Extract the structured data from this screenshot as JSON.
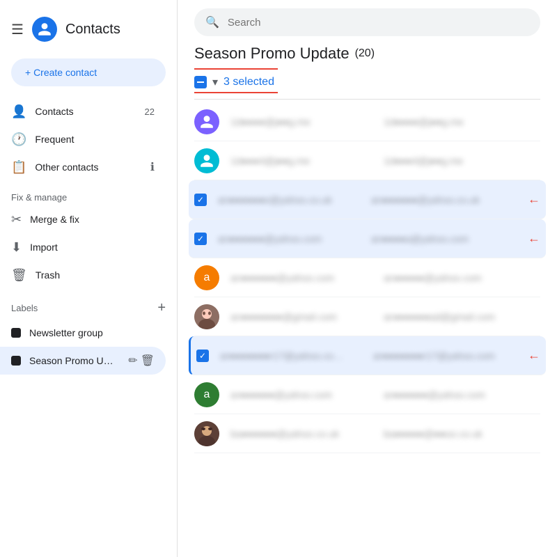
{
  "app": {
    "title": "Contacts"
  },
  "search": {
    "placeholder": "Search"
  },
  "sidebar": {
    "nav_items": [
      {
        "id": "contacts",
        "label": "Contacts",
        "count": "22",
        "icon": "👤"
      },
      {
        "id": "frequent",
        "label": "Frequent",
        "count": "",
        "icon": "🕐"
      },
      {
        "id": "other-contacts",
        "label": "Other contacts",
        "count": "",
        "icon": "📋"
      }
    ],
    "fix_manage_label": "Fix & manage",
    "fix_items": [
      {
        "id": "merge",
        "label": "Merge & fix",
        "icon": "✂"
      },
      {
        "id": "import",
        "label": "Import",
        "icon": "⬇"
      },
      {
        "id": "trash",
        "label": "Trash",
        "icon": "🗑"
      }
    ],
    "labels_title": "Labels",
    "labels": [
      {
        "id": "newsletter",
        "label": "Newsletter group",
        "active": false
      },
      {
        "id": "season",
        "label": "Season Promo U…",
        "active": true
      }
    ],
    "create_btn": "+ Create contact"
  },
  "main": {
    "page_title": "Season Promo Update",
    "page_count": "(20)",
    "selected_label": "3 selected",
    "contacts": [
      {
        "id": 1,
        "avatar_type": "purple",
        "avatar_text": "",
        "email1": "1d●●●●@j●●g.me",
        "email2": "1d●●●●@j●●g.me",
        "selected": false,
        "arrow": false,
        "left_border": false
      },
      {
        "id": 2,
        "avatar_type": "teal",
        "avatar_text": "",
        "email1": "1d●●●4@j●●g.me",
        "email2": "1d●●●4@j●●g.me",
        "selected": false,
        "arrow": false,
        "left_border": false
      },
      {
        "id": 3,
        "avatar_type": "checkbox",
        "avatar_text": "",
        "email1": "an●●●●●●e@yahoo.co.uk",
        "email2": "an●●●●●●@yahoo.co.uk",
        "selected": true,
        "arrow": true,
        "left_border": false
      },
      {
        "id": 4,
        "avatar_type": "checkbox",
        "avatar_text": "",
        "email1": "an●●●●●●@yahoo.com",
        "email2": "an●●●●a@yahoo.com",
        "selected": true,
        "arrow": true,
        "left_border": false
      },
      {
        "id": 5,
        "avatar_type": "orange",
        "avatar_text": "a",
        "email1": "an●●●●●●@yahoo.com",
        "email2": "an●●●●●@yahoo.com",
        "selected": false,
        "arrow": false,
        "left_border": false
      },
      {
        "id": 6,
        "avatar_type": "photo1",
        "avatar_text": "",
        "email1": "an●●●●●●●@gmail.com",
        "email2": "an●●●●●●ad@gmail.com",
        "selected": false,
        "arrow": false,
        "left_border": false
      },
      {
        "id": 7,
        "avatar_type": "checkbox",
        "avatar_text": "",
        "email1": "ar●●●●●●●r17@yahoo.co…",
        "email2": "ar●●●●●●●r17@yahoo.com",
        "selected": true,
        "arrow": true,
        "left_border": true
      },
      {
        "id": 8,
        "avatar_type": "green",
        "avatar_text": "a",
        "email1": "ar●●●●●●@yahoo.com",
        "email2": "ar●●●●●●@yahoo.com",
        "selected": false,
        "arrow": false,
        "left_border": false
      },
      {
        "id": 9,
        "avatar_type": "photo2",
        "avatar_text": "",
        "email1": "ba●●●●●●@yahoo.co.uk",
        "email2": "ba●●●●●@●●oo.co.uk",
        "selected": false,
        "arrow": false,
        "left_border": false
      }
    ]
  }
}
